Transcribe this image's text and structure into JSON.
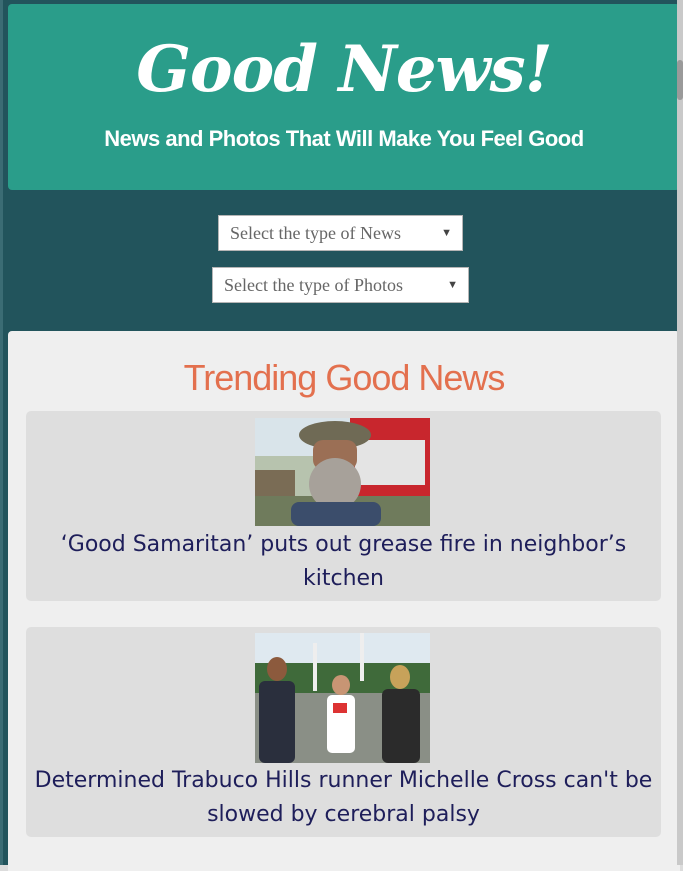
{
  "header": {
    "title": "Good News!",
    "tagline": "News and Photos That Will Make You Feel Good"
  },
  "filters": {
    "news": {
      "selected": "Select the type of News"
    },
    "photos": {
      "selected": "Select the type of Photos"
    }
  },
  "trending": {
    "heading": "Trending Good News",
    "articles": [
      {
        "title": "‘Good Samaritan’ puts out grease fire in neighbor’s kitchen"
      },
      {
        "title": "Determined Trabuco Hills runner Michelle Cross can't be slowed by cerebral palsy"
      }
    ]
  },
  "colors": {
    "header_bg": "#2a9d8a",
    "page_bg": "#22545c",
    "heading": "#e3704e",
    "article_text": "#1e1e5a"
  }
}
